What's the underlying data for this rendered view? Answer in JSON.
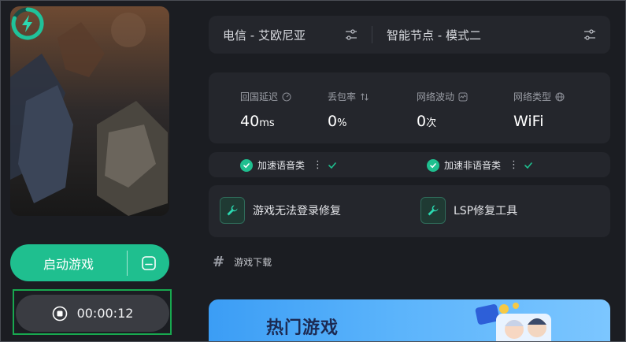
{
  "launcher": {
    "start_label": "启动游戏",
    "timer": "00:00:12"
  },
  "route": {
    "region": "电信 - 艾欧尼亚",
    "node": "智能节点 - 模式二"
  },
  "stats": [
    {
      "label": "回国延迟",
      "value": "40",
      "unit": "ms"
    },
    {
      "label": "丢包率",
      "value": "0",
      "unit": "%"
    },
    {
      "label": "网络波动",
      "value": "0",
      "unit": "次"
    },
    {
      "label": "网络类型",
      "value": "WiFi",
      "unit": ""
    }
  ],
  "toggles": [
    {
      "label": "加速语音类"
    },
    {
      "label": "加速非语音类"
    }
  ],
  "tools": [
    {
      "label": "游戏无法登录修复"
    },
    {
      "label": "LSP修复工具"
    }
  ],
  "downloads": {
    "heading": "游戏下载"
  },
  "banner": {
    "title": "热门游戏"
  },
  "colors": {
    "accent": "#1fbf8f",
    "background": "#1b1d22",
    "card": "#24262c",
    "highlight_border": "#18a84f"
  }
}
